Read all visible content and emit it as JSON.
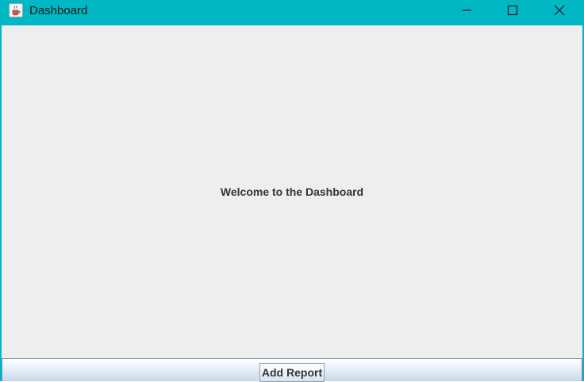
{
  "window": {
    "title": "Dashboard",
    "app_icon": "java-cup-icon",
    "controls": {
      "minimize_icon": "minimize-icon",
      "maximize_icon": "maximize-icon",
      "close_icon": "close-icon"
    },
    "titlebar_color": "#00b7c3"
  },
  "main": {
    "welcome_text": "Welcome to the Dashboard",
    "background": "#eeeeee"
  },
  "footer": {
    "add_report_label": "Add Report"
  }
}
